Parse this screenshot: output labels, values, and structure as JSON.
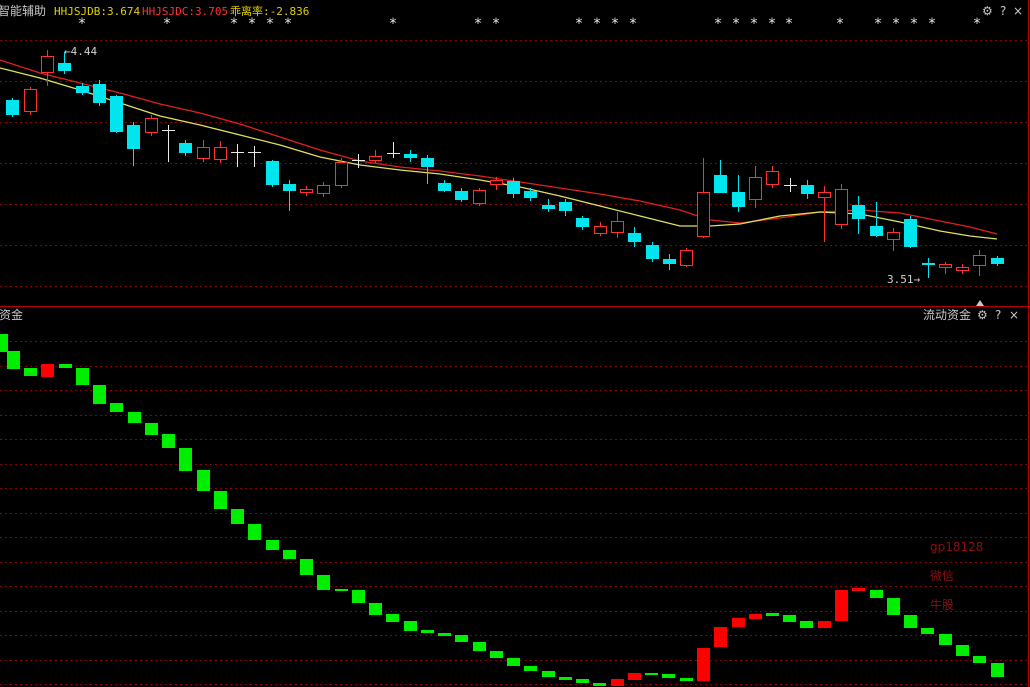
{
  "top_panel": {
    "indicator_name": "智能辅助",
    "items": [
      {
        "label": "HHJSJDB",
        "value": "3.674",
        "color": "#e0d000"
      },
      {
        "label": "HHJSJDC",
        "value": "3.705",
        "color": "#ff3030"
      },
      {
        "label": "乖离率",
        "value": "-2.836",
        "color": "#e0d000"
      }
    ],
    "high_label": "←4.44",
    "low_label": "3.51→",
    "star_glyph": "*",
    "controls": {
      "settings_icon": "gear-icon",
      "help": "?",
      "close": "×"
    }
  },
  "bottom_panel": {
    "left_title": "资金",
    "right_title": "流动资金",
    "controls": {
      "settings_icon": "gear-icon",
      "help": "?",
      "close": "×"
    }
  },
  "watermark": {
    "lines": [
      "gp18128",
      "微信",
      "牛股"
    ],
    "color": "#8a1010"
  },
  "colors": {
    "up": "#ff3030",
    "down": "#00e5ee",
    "fund_up": "#ff0000",
    "fund_down": "#00ee00",
    "ma_red": "#e02020",
    "ma_yellow": "#e0e060",
    "grid": "#8b0000",
    "border": "#b00000"
  }
}
